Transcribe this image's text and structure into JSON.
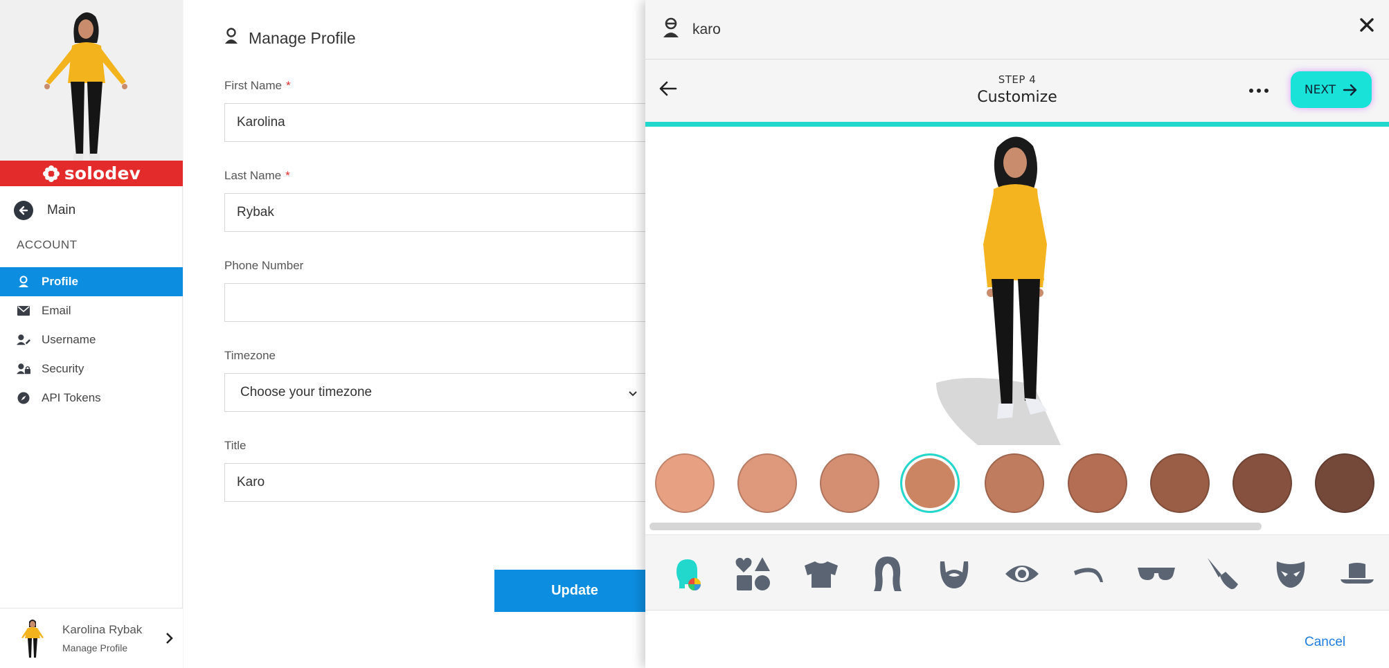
{
  "sidebar": {
    "brand": "solodev",
    "main_link": "Main",
    "section": "ACCOUNT",
    "items": [
      {
        "label": "Profile",
        "icon": "profile-icon",
        "active": true
      },
      {
        "label": "Email",
        "icon": "envelope-icon",
        "active": false
      },
      {
        "label": "Username",
        "icon": "user-edit-icon",
        "active": false
      },
      {
        "label": "Security",
        "icon": "user-lock-icon",
        "active": false
      },
      {
        "label": "API Tokens",
        "icon": "compass-icon",
        "active": false
      }
    ],
    "user": {
      "name": "Karolina Rybak",
      "subtitle": "Manage Profile"
    }
  },
  "form": {
    "title": "Manage Profile",
    "first_name": {
      "label": "First Name",
      "required": "*",
      "value": "Karolina"
    },
    "last_name": {
      "label": "Last Name",
      "required": "*",
      "value": "Rybak"
    },
    "phone": {
      "label": "Phone Number",
      "value": ""
    },
    "timezone": {
      "label": "Timezone",
      "value": "Choose your timezone"
    },
    "title_field": {
      "label": "Title",
      "value": "Karo"
    },
    "update_button": "Update"
  },
  "panel": {
    "username": "karo",
    "step_number": "STEP 4",
    "step_name": "Customize",
    "next_label": "NEXT",
    "cancel_label": "Cancel",
    "skin_tones": [
      "#e8a082",
      "#de987b",
      "#d48e72",
      "#cb8563",
      "#c07c5f",
      "#b36e53",
      "#9a5e47",
      "#86523f",
      "#74493a"
    ],
    "selected_tone_index": 3,
    "categories": [
      {
        "icon": "skin-tone-icon",
        "active": true
      },
      {
        "icon": "shapes-icon",
        "active": false
      },
      {
        "icon": "shirt-icon",
        "active": false
      },
      {
        "icon": "hair-icon",
        "active": false
      },
      {
        "icon": "beard-icon",
        "active": false
      },
      {
        "icon": "eye-icon",
        "active": false
      },
      {
        "icon": "eyebrow-icon",
        "active": false
      },
      {
        "icon": "glasses-icon",
        "active": false
      },
      {
        "icon": "makeup-brush-icon",
        "active": false
      },
      {
        "icon": "mask-icon",
        "active": false
      },
      {
        "icon": "hat-icon",
        "active": false
      }
    ],
    "colors": {
      "accent": "#22d8cc",
      "category_icon": "#5b6472"
    }
  },
  "colors": {
    "primary": "#0d8de0",
    "brand_red": "#e32b2b",
    "link": "#1f7de0"
  }
}
